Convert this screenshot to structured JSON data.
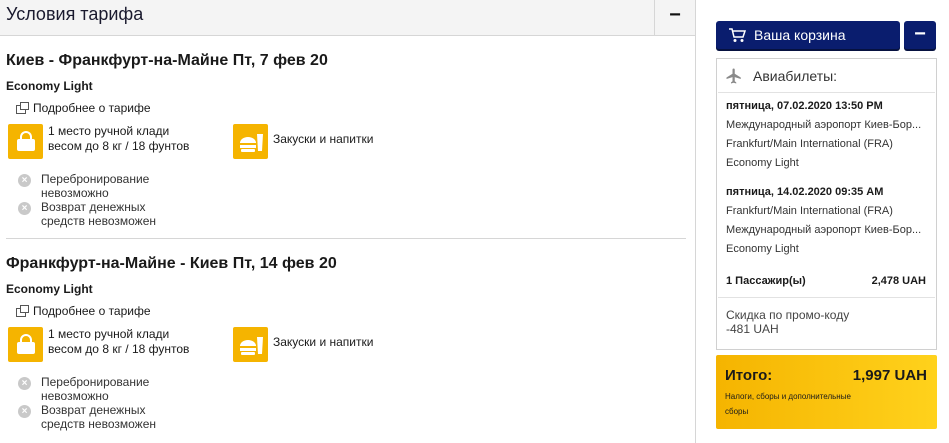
{
  "section": {
    "title": "Условия тарифа",
    "toggle": "−"
  },
  "flights": [
    {
      "route": "Киев - Франкфурт-на-Майне Пт, 7 фев 20",
      "fare_class": "Economy Light",
      "details_link": "Подробнее о тарифе",
      "baggage": [
        "1 место ручной клади",
        "весом до 8 кг / 18 фунтов"
      ],
      "snacks": "Закуски и напитки",
      "rebooking": [
        "Перебронирование",
        "невозможно"
      ],
      "refund": [
        "Возврат денежных",
        "средств невозможен"
      ]
    },
    {
      "route": "Франкфурт-на-Майне - Киев Пт, 14 фев 20",
      "fare_class": "Economy Light",
      "details_link": "Подробнее о тарифе",
      "baggage": [
        "1 место ручной клади",
        "весом до 8 кг / 18 фунтов"
      ],
      "snacks": "Закуски и напитки",
      "rebooking": [
        "Перебронирование",
        "невозможно"
      ],
      "refund": [
        "Возврат денежных",
        "средств невозможен"
      ]
    }
  ],
  "cart": {
    "button_label": "Ваша корзина",
    "collapse_label": "−",
    "icon": "cart-icon",
    "accent": "#0a1d6e"
  },
  "summary": {
    "title": "Авиабилеты:",
    "icon": "plane-icon",
    "segments": [
      {
        "datetime": "пятница, 07.02.2020 13:50 PM",
        "from": "Международный аэропорт Киев-Бор...",
        "to": "Frankfurt/Main International (FRA)",
        "fare": "Economy Light"
      },
      {
        "datetime": "пятница, 14.02.2020 09:35 AM",
        "from": "Frankfurt/Main International (FRA)",
        "to": "Международный аэропорт Киев-Бор...",
        "fare": "Economy Light"
      }
    ],
    "passengers": "1 Пассажир(ы)",
    "passengers_price": "2,478 UAH",
    "promo_label": "Скидка по промо-коду",
    "promo_value": "-481 UAH"
  },
  "total": {
    "label": "Итого:",
    "amount": "1,997 UAH",
    "note": "Налоги, сборы и дополнительные сборы",
    "accent": "#f5b400"
  }
}
